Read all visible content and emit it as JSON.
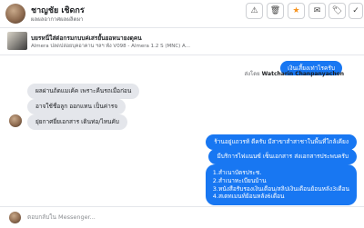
{
  "header": {
    "name": "ชาญชัย เชิดกร",
    "subtitle": "ผลผลอากาศผลผลิตผา",
    "chevron": "⌄",
    "buttons": [
      {
        "icon": "warning-icon",
        "glyph": "⚠"
      },
      {
        "icon": "trash-icon",
        "glyph": "🗑"
      },
      {
        "icon": "star-icon",
        "glyph": "★"
      },
      {
        "icon": "mail-icon",
        "glyph": "✉"
      },
      {
        "icon": "tag-icon",
        "glyph": "🏷"
      },
      {
        "icon": "check-icon",
        "glyph": "✓"
      }
    ]
  },
  "listing": {
    "title": "บยรหนี่ใส่ต่อกรมกบบค่เสรยั้นยอหนายงดุคน",
    "subtitle": "Almera ปลดปล่อยบุคอาคาน ฯลฯ พัง V098 - Almera 1.2 S (MNC) A..."
  },
  "notice": {
    "text": "เงินเสี้ยงเท่าไรครับ",
    "sent_by_prefix": "ส่งโดย",
    "sent_by_name": "Watcharin Chanpanyachon"
  },
  "incoming": [
    "ผลผ่านถ้ดแมเค้ค เพราะคืนรถเมื่อก่อน",
    "อาจใช้ชื่อลูก ออกแทน เป็นค่ารจ",
    "ยุ่ยกาศยี่ยเอกสาร เดินท่อ/ไหนคับ"
  ],
  "outgoing": {
    "msg1": "ร้านอยู่แถวรท้ ดีครับ มีสาขาสำสาชาในพื้นที่ใกล้เคียง",
    "msg2": "มีบริการไฟแนนซ์ เซ็นเอกสาร ส่งเอกสารประพบครับ",
    "list": [
      "1.สำเนาบัตรประช.",
      "2.สำเนาทะเบียนบ้าน",
      "3.หนังสือรับรองเงินเดือน/สลิปเงินเดือนย้อนหลัง3เดือน",
      "4.สเตทเมนท์ย้อนหลัง6เดือน"
    ]
  },
  "composer": {
    "placeholder": "ตอบกลับใน Messenger..."
  },
  "colors": {
    "accent": "#1877f2",
    "incoming_bg": "#e4e6eb",
    "star": "#f7931e"
  }
}
